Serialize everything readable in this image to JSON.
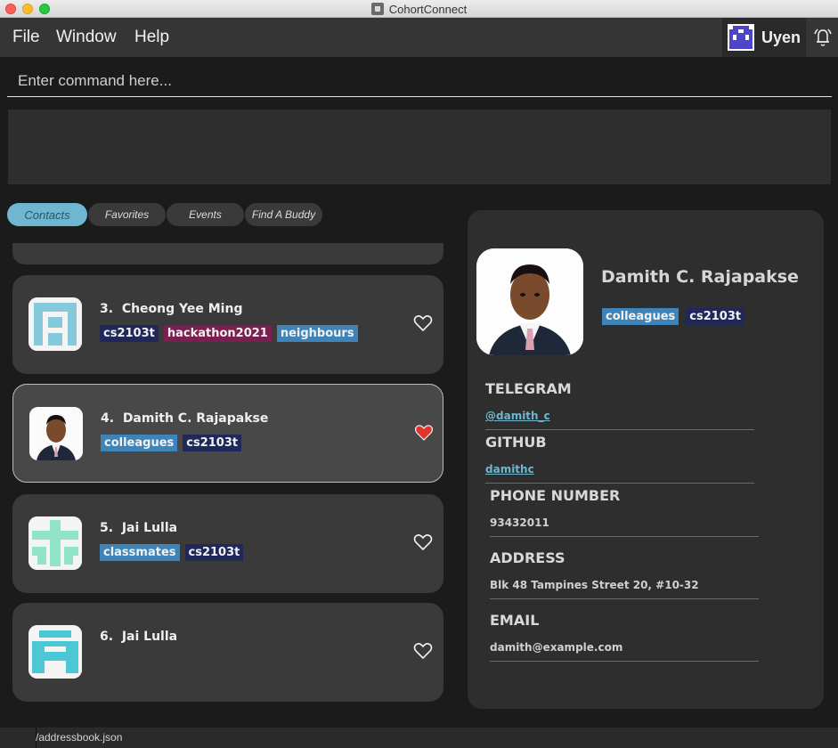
{
  "window": {
    "title": "CohortConnect"
  },
  "menu": {
    "file": "File",
    "window": "Window",
    "help": "Help"
  },
  "user": {
    "name": "Uyen"
  },
  "command": {
    "placeholder": "Enter command here..."
  },
  "tabs": [
    {
      "label": "Contacts",
      "active": true
    },
    {
      "label": "Favorites",
      "active": false
    },
    {
      "label": "Events",
      "active": false
    },
    {
      "label": "Find A Buddy",
      "active": false
    }
  ],
  "contacts": [
    {
      "index": "3.",
      "name": "Cheong Yee Ming",
      "favorite": false,
      "tags": [
        {
          "label": "cs2103t",
          "color": "#20285a"
        },
        {
          "label": "hackathon2021",
          "color": "#7a1f4f"
        },
        {
          "label": "neighbours",
          "color": "#3f84b8"
        }
      ],
      "avatar_color": "#86c9dc"
    },
    {
      "index": "4.",
      "name": "Damith C. Rajapakse",
      "favorite": true,
      "tags": [
        {
          "label": "colleagues",
          "color": "#3f84b8"
        },
        {
          "label": "cs2103t",
          "color": "#20285a"
        }
      ],
      "avatar_color": "photo"
    },
    {
      "index": "5.",
      "name": "Jai Lulla",
      "favorite": false,
      "tags": [
        {
          "label": "classmates",
          "color": "#3f84b8"
        },
        {
          "label": "cs2103t",
          "color": "#20285a"
        }
      ],
      "avatar_color": "#8fe3c9"
    },
    {
      "index": "6.",
      "name": "Jai Lulla",
      "favorite": false,
      "tags": [],
      "avatar_color": "#4cc7d6"
    }
  ],
  "detail": {
    "name": "Damith C. Rajapakse",
    "tags": [
      {
        "label": "colleagues",
        "color": "#3f84b8"
      },
      {
        "label": "cs2103t",
        "color": "#20285a"
      }
    ],
    "telegram_label": "TELEGRAM",
    "telegram": "@damith_c",
    "github_label": "GITHUB",
    "github": "damithc",
    "phone_label": "PHONE NUMBER",
    "phone": "93432011",
    "address_label": "ADDRESS",
    "address": "Blk 48 Tampines Street 20, #10-32",
    "email_label": "EMAIL",
    "email": "damith@example.com"
  },
  "status": {
    "path": "/addressbook.json"
  },
  "icons": {
    "heart_outline": "heart-outline-icon",
    "heart_filled": "heart-filled-icon",
    "bell": "bell-icon"
  },
  "colors": {
    "accent": "#6fb7d1",
    "heart_active": "#e0352b"
  }
}
